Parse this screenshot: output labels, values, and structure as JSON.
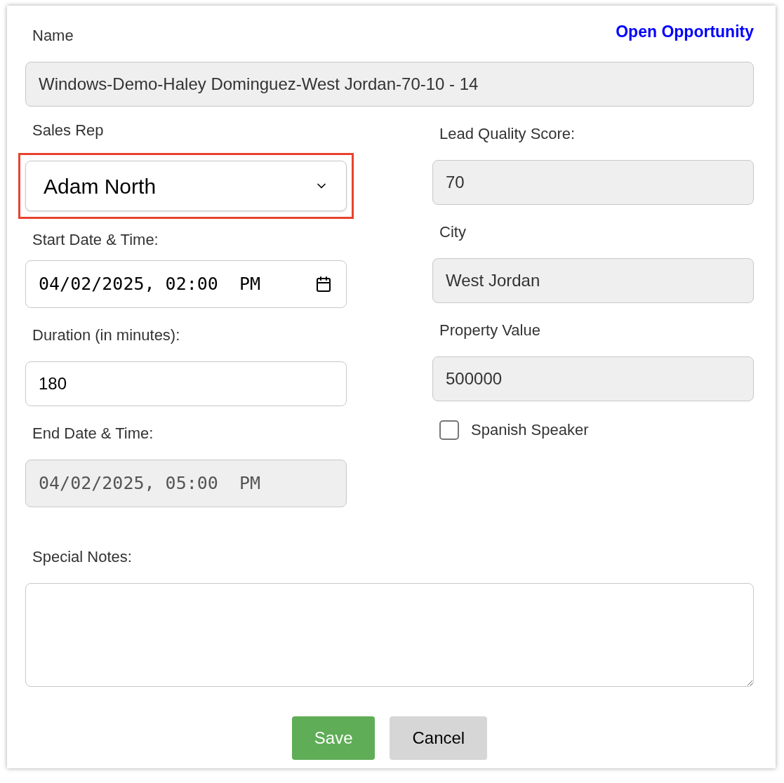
{
  "link": "Open Opportunity",
  "name": {
    "label": "Name",
    "value": "Windows-Demo-Haley Dominguez-West Jordan-70-10 - 14",
    "readonly": true
  },
  "left_fields": [
    {
      "kind": "select",
      "label": "Sales Rep",
      "value": "Adam North",
      "highlighted": true,
      "readonly": false
    },
    {
      "kind": "datetime",
      "label": "Start Date & Time:",
      "value": "04/02/2025, 02:00  PM",
      "readonly": false
    },
    {
      "kind": "text",
      "label": "Duration (in minutes):",
      "value": "180",
      "readonly": false
    },
    {
      "kind": "datetime",
      "label": "End Date & Time:",
      "value": "04/02/2025, 05:00  PM",
      "readonly": true
    }
  ],
  "right_fields": [
    {
      "label": "Lead Quality Score:",
      "value": "70",
      "readonly": true
    },
    {
      "label": "City",
      "value": "West Jordan",
      "readonly": true
    },
    {
      "label": "Property Value",
      "value": "500000",
      "readonly": true
    }
  ],
  "checkbox": {
    "label": "Spanish Speaker",
    "checked": false
  },
  "notes": {
    "label": "Special Notes:"
  },
  "buttons": [
    {
      "kind": "primary",
      "label": "Save"
    },
    {
      "kind": "secondary",
      "label": "Cancel"
    }
  ]
}
